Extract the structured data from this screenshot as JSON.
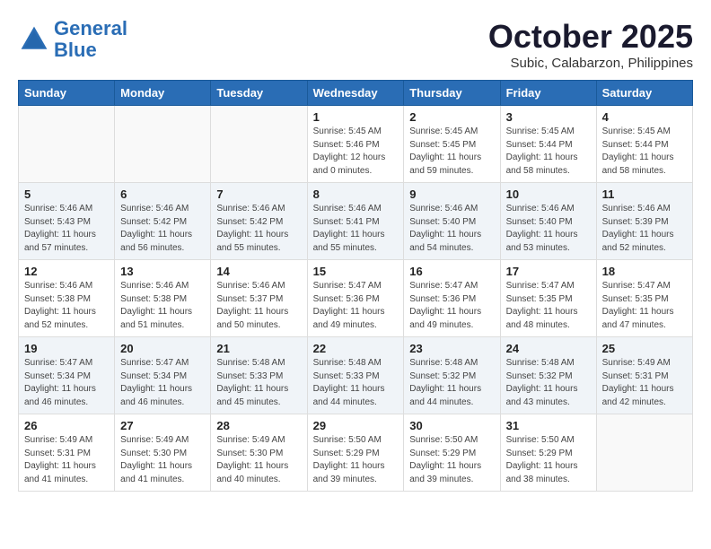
{
  "header": {
    "logo_line1": "General",
    "logo_line2": "Blue",
    "month": "October 2025",
    "location": "Subic, Calabarzon, Philippines"
  },
  "days_of_week": [
    "Sunday",
    "Monday",
    "Tuesday",
    "Wednesday",
    "Thursday",
    "Friday",
    "Saturday"
  ],
  "weeks": [
    [
      {
        "day": "",
        "info": ""
      },
      {
        "day": "",
        "info": ""
      },
      {
        "day": "",
        "info": ""
      },
      {
        "day": "1",
        "info": "Sunrise: 5:45 AM\nSunset: 5:46 PM\nDaylight: 12 hours\nand 0 minutes."
      },
      {
        "day": "2",
        "info": "Sunrise: 5:45 AM\nSunset: 5:45 PM\nDaylight: 11 hours\nand 59 minutes."
      },
      {
        "day": "3",
        "info": "Sunrise: 5:45 AM\nSunset: 5:44 PM\nDaylight: 11 hours\nand 58 minutes."
      },
      {
        "day": "4",
        "info": "Sunrise: 5:45 AM\nSunset: 5:44 PM\nDaylight: 11 hours\nand 58 minutes."
      }
    ],
    [
      {
        "day": "5",
        "info": "Sunrise: 5:46 AM\nSunset: 5:43 PM\nDaylight: 11 hours\nand 57 minutes."
      },
      {
        "day": "6",
        "info": "Sunrise: 5:46 AM\nSunset: 5:42 PM\nDaylight: 11 hours\nand 56 minutes."
      },
      {
        "day": "7",
        "info": "Sunrise: 5:46 AM\nSunset: 5:42 PM\nDaylight: 11 hours\nand 55 minutes."
      },
      {
        "day": "8",
        "info": "Sunrise: 5:46 AM\nSunset: 5:41 PM\nDaylight: 11 hours\nand 55 minutes."
      },
      {
        "day": "9",
        "info": "Sunrise: 5:46 AM\nSunset: 5:40 PM\nDaylight: 11 hours\nand 54 minutes."
      },
      {
        "day": "10",
        "info": "Sunrise: 5:46 AM\nSunset: 5:40 PM\nDaylight: 11 hours\nand 53 minutes."
      },
      {
        "day": "11",
        "info": "Sunrise: 5:46 AM\nSunset: 5:39 PM\nDaylight: 11 hours\nand 52 minutes."
      }
    ],
    [
      {
        "day": "12",
        "info": "Sunrise: 5:46 AM\nSunset: 5:38 PM\nDaylight: 11 hours\nand 52 minutes."
      },
      {
        "day": "13",
        "info": "Sunrise: 5:46 AM\nSunset: 5:38 PM\nDaylight: 11 hours\nand 51 minutes."
      },
      {
        "day": "14",
        "info": "Sunrise: 5:46 AM\nSunset: 5:37 PM\nDaylight: 11 hours\nand 50 minutes."
      },
      {
        "day": "15",
        "info": "Sunrise: 5:47 AM\nSunset: 5:36 PM\nDaylight: 11 hours\nand 49 minutes."
      },
      {
        "day": "16",
        "info": "Sunrise: 5:47 AM\nSunset: 5:36 PM\nDaylight: 11 hours\nand 49 minutes."
      },
      {
        "day": "17",
        "info": "Sunrise: 5:47 AM\nSunset: 5:35 PM\nDaylight: 11 hours\nand 48 minutes."
      },
      {
        "day": "18",
        "info": "Sunrise: 5:47 AM\nSunset: 5:35 PM\nDaylight: 11 hours\nand 47 minutes."
      }
    ],
    [
      {
        "day": "19",
        "info": "Sunrise: 5:47 AM\nSunset: 5:34 PM\nDaylight: 11 hours\nand 46 minutes."
      },
      {
        "day": "20",
        "info": "Sunrise: 5:47 AM\nSunset: 5:34 PM\nDaylight: 11 hours\nand 46 minutes."
      },
      {
        "day": "21",
        "info": "Sunrise: 5:48 AM\nSunset: 5:33 PM\nDaylight: 11 hours\nand 45 minutes."
      },
      {
        "day": "22",
        "info": "Sunrise: 5:48 AM\nSunset: 5:33 PM\nDaylight: 11 hours\nand 44 minutes."
      },
      {
        "day": "23",
        "info": "Sunrise: 5:48 AM\nSunset: 5:32 PM\nDaylight: 11 hours\nand 44 minutes."
      },
      {
        "day": "24",
        "info": "Sunrise: 5:48 AM\nSunset: 5:32 PM\nDaylight: 11 hours\nand 43 minutes."
      },
      {
        "day": "25",
        "info": "Sunrise: 5:49 AM\nSunset: 5:31 PM\nDaylight: 11 hours\nand 42 minutes."
      }
    ],
    [
      {
        "day": "26",
        "info": "Sunrise: 5:49 AM\nSunset: 5:31 PM\nDaylight: 11 hours\nand 41 minutes."
      },
      {
        "day": "27",
        "info": "Sunrise: 5:49 AM\nSunset: 5:30 PM\nDaylight: 11 hours\nand 41 minutes."
      },
      {
        "day": "28",
        "info": "Sunrise: 5:49 AM\nSunset: 5:30 PM\nDaylight: 11 hours\nand 40 minutes."
      },
      {
        "day": "29",
        "info": "Sunrise: 5:50 AM\nSunset: 5:29 PM\nDaylight: 11 hours\nand 39 minutes."
      },
      {
        "day": "30",
        "info": "Sunrise: 5:50 AM\nSunset: 5:29 PM\nDaylight: 11 hours\nand 39 minutes."
      },
      {
        "day": "31",
        "info": "Sunrise: 5:50 AM\nSunset: 5:29 PM\nDaylight: 11 hours\nand 38 minutes."
      },
      {
        "day": "",
        "info": ""
      }
    ]
  ]
}
